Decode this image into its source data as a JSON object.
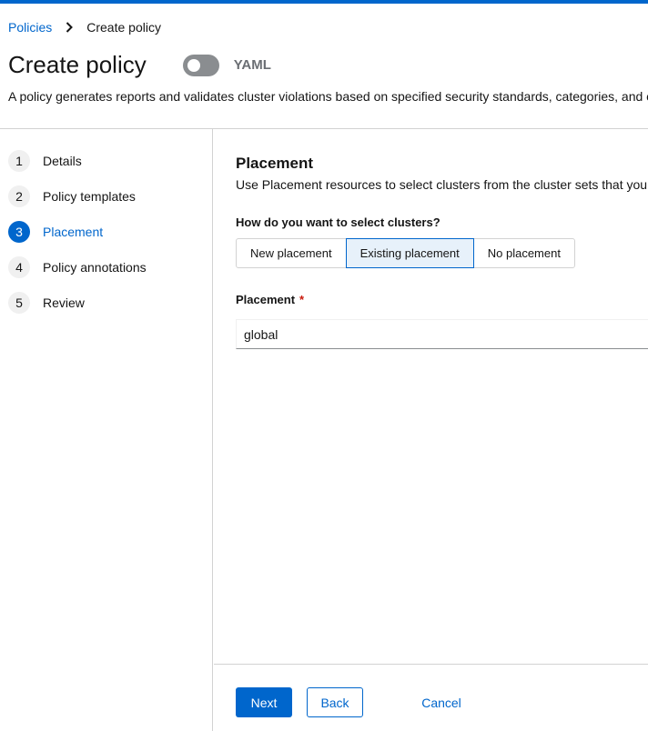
{
  "colors": {
    "accent": "#0066cc",
    "required": "#c9190b",
    "toggle_off": "#8a8d90"
  },
  "breadcrumb": {
    "parent": "Policies",
    "current": "Create policy",
    "separator_icon": "chevron-right-icon"
  },
  "header": {
    "title": "Create policy",
    "yaml_toggle_label": "YAML",
    "yaml_toggle_on": false,
    "description": "A policy generates reports and validates cluster violations based on specified security standards, categories, and c"
  },
  "wizard_nav": {
    "steps": [
      {
        "number": "1",
        "label": "Details"
      },
      {
        "number": "2",
        "label": "Policy templates"
      },
      {
        "number": "3",
        "label": "Placement",
        "active": true
      },
      {
        "number": "4",
        "label": "Policy annotations"
      },
      {
        "number": "5",
        "label": "Review"
      }
    ]
  },
  "main": {
    "section_title": "Placement",
    "section_description": "Use Placement resources to select clusters from the cluster sets that you have",
    "question": "How do you want to select clusters?",
    "options": [
      {
        "label": "New placement",
        "selected": false
      },
      {
        "label": "Existing placement",
        "selected": true
      },
      {
        "label": "No placement",
        "selected": false
      }
    ],
    "placement_label": "Placement",
    "required_marker": "*",
    "placement_value": "global"
  },
  "footer": {
    "next_label": "Next",
    "back_label": "Back",
    "cancel_label": "Cancel"
  }
}
